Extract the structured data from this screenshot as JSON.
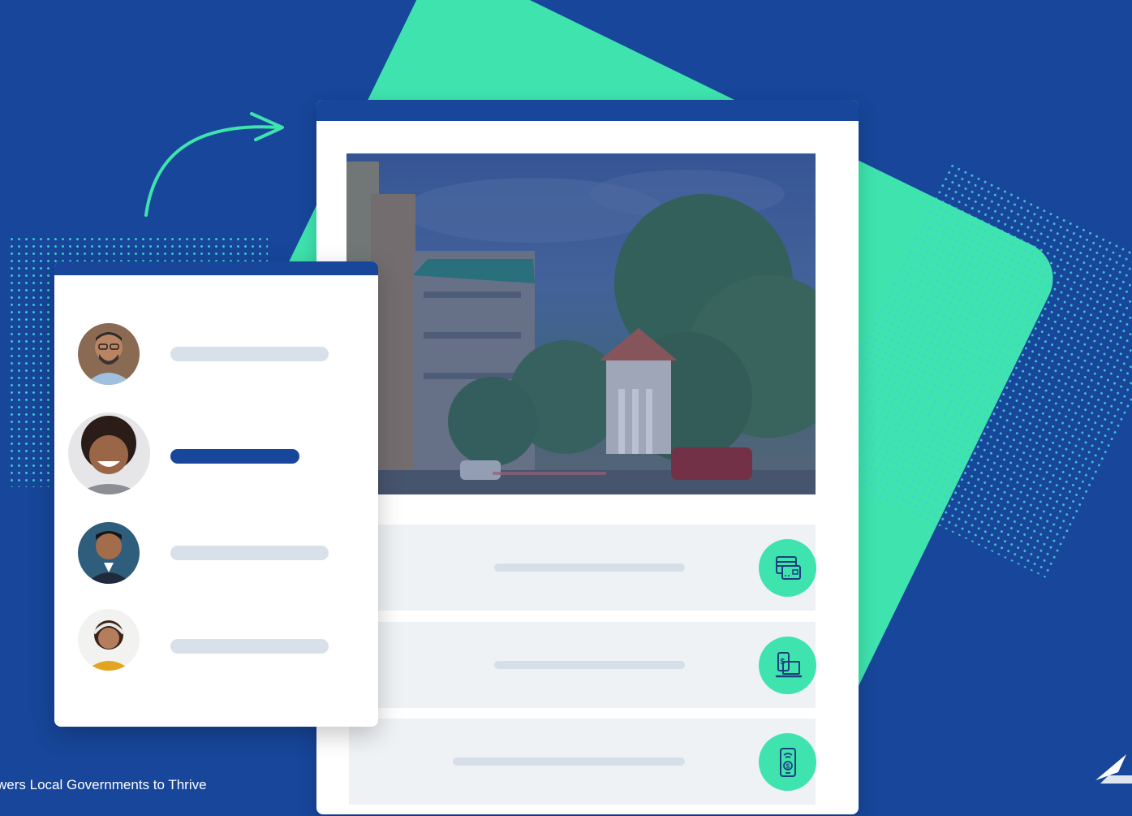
{
  "footer": {
    "tagline": "wers Local Governments to Thrive"
  },
  "colors": {
    "background": "#17469a",
    "accent_green": "#3ee3ae",
    "card": "#ffffff",
    "placeholder_line": "#d6dfe8",
    "active_line": "#17469a"
  },
  "people_list": [
    {
      "avatar": "man-with-glasses-avatar",
      "selected": false
    },
    {
      "avatar": "smiling-woman-curly-hair-avatar",
      "selected": true
    },
    {
      "avatar": "man-in-suit-avatar",
      "selected": false
    },
    {
      "avatar": "woman-with-headset-avatar",
      "selected": false
    }
  ],
  "payment_options": [
    {
      "icon": "credit-card-icon"
    },
    {
      "icon": "online-payment-laptop-icon"
    },
    {
      "icon": "mobile-payment-icon"
    }
  ],
  "hero_image": "town-street-photo"
}
